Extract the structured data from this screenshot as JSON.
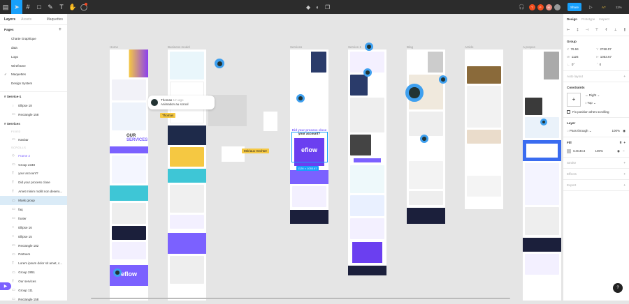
{
  "toolbar": {
    "share": "Share",
    "zoom": "11%",
    "user_initials": [
      "T",
      "P",
      "M"
    ],
    "at": "A?"
  },
  "left_panel": {
    "tabs": [
      "Layers",
      "Assets"
    ],
    "page_selector": "Maquettes",
    "pages_label": "Pages",
    "pages": [
      "Charte Graphique",
      "data",
      "Logo",
      "Wireframe",
      "Maquettes",
      "Design System"
    ],
    "current_page": "Maquettes",
    "frame1": "Service-1",
    "frame1_layers": [
      "Ellipse 18",
      "Rectangle 158"
    ],
    "frame2": "Services",
    "fixed_label": "FIXED",
    "fixed_layers": [
      "Navbar"
    ],
    "scrolls_label": "SCROLLS",
    "scroll_layers": [
      "Frame 2",
      "Group 2348",
      "your account?",
      "Did your process close",
      "Amet minim mollit non deseru...",
      "Mask group",
      "faq",
      "footer",
      "Ellipse 16",
      "Ellipse 15",
      "Rectangle 182",
      "Partners",
      "Lorem ipsum dolor sit amet, c...",
      "Group 2851",
      "Our services",
      "Group 111",
      "Rectangle 158"
    ]
  },
  "canvas": {
    "frames": [
      "Home",
      "Business model",
      "Services",
      "Service-1",
      "Blog",
      "Article",
      "A propos"
    ],
    "comment": {
      "author": "Thomas",
      "time": "1m ago",
      "text": "Animation au scrool"
    },
    "cursor_labels": [
      "Thomas",
      "Mériaux Hechter"
    ],
    "selection_size": "1126 × 1053.67",
    "texts": {
      "our": "OUR",
      "services": "SERVICES",
      "eflow": "eflow",
      "account": "your account?",
      "process": "Did your process close"
    }
  },
  "right_panel": {
    "tabs": [
      "Design",
      "Prototype",
      "Inspect"
    ],
    "group_label": "Group",
    "x": "76.94",
    "y": "2768.07",
    "w": "1126",
    "h": "1053.67",
    "rotation": "0°",
    "radius": "0",
    "auto_layout": "Auto layout",
    "constraints_label": "Constraints",
    "h_constraint": "Right",
    "v_constraint": "Top",
    "fix_position": "Fix position when scrolling",
    "layer_label": "Layer",
    "blend": "Pass through",
    "layer_opacity": "100%",
    "fill_label": "Fill",
    "fill_hex": "C4C4C4",
    "fill_opacity": "100%",
    "fill_color": "#c4c4c4",
    "stroke": "Stroke",
    "effects": "Effects",
    "export": "Export"
  },
  "help": "?"
}
